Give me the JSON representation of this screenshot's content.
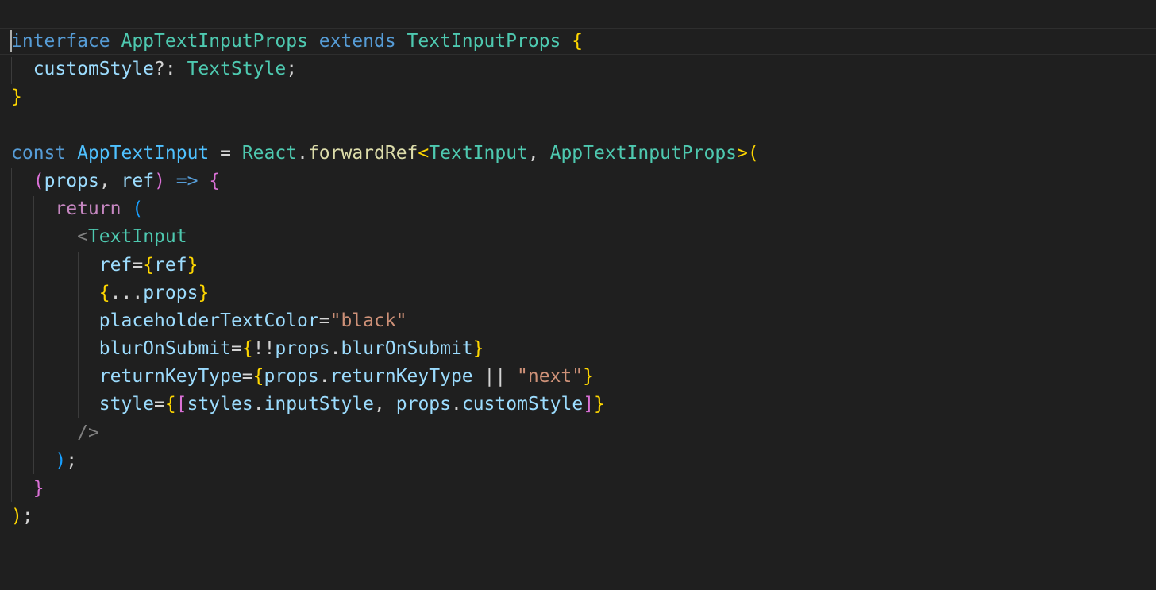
{
  "editor": {
    "theme_colors": {
      "background": "#1f1f1f",
      "keyword": "#569cd6",
      "control": "#c586c0",
      "type": "#4ec9b0",
      "variable": "#9cdcfe",
      "function": "#dcdcaa",
      "string": "#ce9178",
      "bracket_1": "#ffd700",
      "bracket_2": "#da70d6",
      "bracket_3": "#179fff"
    },
    "lines": [
      [
        {
          "t": "interface",
          "c": "kw"
        },
        {
          "t": " ",
          "c": "pu"
        },
        {
          "t": "AppTextInputProps",
          "c": "ty"
        },
        {
          "t": " ",
          "c": "pu"
        },
        {
          "t": "extends",
          "c": "kw"
        },
        {
          "t": " ",
          "c": "pu"
        },
        {
          "t": "TextInputProps",
          "c": "ty"
        },
        {
          "t": " ",
          "c": "pu"
        },
        {
          "t": "{",
          "c": "b1"
        }
      ],
      [
        {
          "t": "  ",
          "c": "pu"
        },
        {
          "t": "customStyle",
          "c": "vr"
        },
        {
          "t": "?: ",
          "c": "pu"
        },
        {
          "t": "TextStyle",
          "c": "ty"
        },
        {
          "t": ";",
          "c": "pu"
        }
      ],
      [
        {
          "t": "}",
          "c": "b1"
        }
      ],
      [],
      [
        {
          "t": "const",
          "c": "kw"
        },
        {
          "t": " ",
          "c": "pu"
        },
        {
          "t": "AppTextInput",
          "c": "cn"
        },
        {
          "t": " = ",
          "c": "pu"
        },
        {
          "t": "React",
          "c": "ty"
        },
        {
          "t": ".",
          "c": "pu"
        },
        {
          "t": "forwardRef",
          "c": "fn"
        },
        {
          "t": "<",
          "c": "b1"
        },
        {
          "t": "TextInput",
          "c": "ty"
        },
        {
          "t": ", ",
          "c": "pu"
        },
        {
          "t": "AppTextInputProps",
          "c": "ty"
        },
        {
          "t": ">",
          "c": "b1"
        },
        {
          "t": "(",
          "c": "b1"
        }
      ],
      [
        {
          "t": "  ",
          "c": "pu"
        },
        {
          "t": "(",
          "c": "b2"
        },
        {
          "t": "props",
          "c": "vr"
        },
        {
          "t": ", ",
          "c": "pu"
        },
        {
          "t": "ref",
          "c": "vr"
        },
        {
          "t": ")",
          "c": "b2"
        },
        {
          "t": " ",
          "c": "pu"
        },
        {
          "t": "=>",
          "c": "kw"
        },
        {
          "t": " ",
          "c": "pu"
        },
        {
          "t": "{",
          "c": "b2"
        }
      ],
      [
        {
          "t": "    ",
          "c": "pu"
        },
        {
          "t": "return",
          "c": "ctl"
        },
        {
          "t": " ",
          "c": "pu"
        },
        {
          "t": "(",
          "c": "b3"
        }
      ],
      [
        {
          "t": "      ",
          "c": "pu"
        },
        {
          "t": "<",
          "c": "tag"
        },
        {
          "t": "TextInput",
          "c": "ty"
        }
      ],
      [
        {
          "t": "        ",
          "c": "pu"
        },
        {
          "t": "ref",
          "c": "vr"
        },
        {
          "t": "=",
          "c": "pu"
        },
        {
          "t": "{",
          "c": "b1"
        },
        {
          "t": "ref",
          "c": "vr"
        },
        {
          "t": "}",
          "c": "b1"
        }
      ],
      [
        {
          "t": "        ",
          "c": "pu"
        },
        {
          "t": "{",
          "c": "b1"
        },
        {
          "t": "...",
          "c": "pu"
        },
        {
          "t": "props",
          "c": "vr"
        },
        {
          "t": "}",
          "c": "b1"
        }
      ],
      [
        {
          "t": "        ",
          "c": "pu"
        },
        {
          "t": "placeholderTextColor",
          "c": "vr"
        },
        {
          "t": "=",
          "c": "pu"
        },
        {
          "t": "\"black\"",
          "c": "str"
        }
      ],
      [
        {
          "t": "        ",
          "c": "pu"
        },
        {
          "t": "blurOnSubmit",
          "c": "vr"
        },
        {
          "t": "=",
          "c": "pu"
        },
        {
          "t": "{",
          "c": "b1"
        },
        {
          "t": "!!",
          "c": "pu"
        },
        {
          "t": "props",
          "c": "vr"
        },
        {
          "t": ".",
          "c": "pu"
        },
        {
          "t": "blurOnSubmit",
          "c": "vr"
        },
        {
          "t": "}",
          "c": "b1"
        }
      ],
      [
        {
          "t": "        ",
          "c": "pu"
        },
        {
          "t": "returnKeyType",
          "c": "vr"
        },
        {
          "t": "=",
          "c": "pu"
        },
        {
          "t": "{",
          "c": "b1"
        },
        {
          "t": "props",
          "c": "vr"
        },
        {
          "t": ".",
          "c": "pu"
        },
        {
          "t": "returnKeyType",
          "c": "vr"
        },
        {
          "t": " || ",
          "c": "pu"
        },
        {
          "t": "\"next\"",
          "c": "str"
        },
        {
          "t": "}",
          "c": "b1"
        }
      ],
      [
        {
          "t": "        ",
          "c": "pu"
        },
        {
          "t": "style",
          "c": "vr"
        },
        {
          "t": "=",
          "c": "pu"
        },
        {
          "t": "{",
          "c": "b1"
        },
        {
          "t": "[",
          "c": "b2"
        },
        {
          "t": "styles",
          "c": "vr"
        },
        {
          "t": ".",
          "c": "pu"
        },
        {
          "t": "inputStyle",
          "c": "vr"
        },
        {
          "t": ", ",
          "c": "pu"
        },
        {
          "t": "props",
          "c": "vr"
        },
        {
          "t": ".",
          "c": "pu"
        },
        {
          "t": "customStyle",
          "c": "vr"
        },
        {
          "t": "]",
          "c": "b2"
        },
        {
          "t": "}",
          "c": "b1"
        }
      ],
      [
        {
          "t": "      ",
          "c": "pu"
        },
        {
          "t": "/>",
          "c": "tag"
        }
      ],
      [
        {
          "t": "    ",
          "c": "pu"
        },
        {
          "t": ")",
          "c": "b3"
        },
        {
          "t": ";",
          "c": "pu"
        }
      ],
      [
        {
          "t": "  ",
          "c": "pu"
        },
        {
          "t": "}",
          "c": "b2"
        }
      ],
      [
        {
          "t": ")",
          "c": "b1"
        },
        {
          "t": ";",
          "c": "pu"
        }
      ]
    ]
  }
}
